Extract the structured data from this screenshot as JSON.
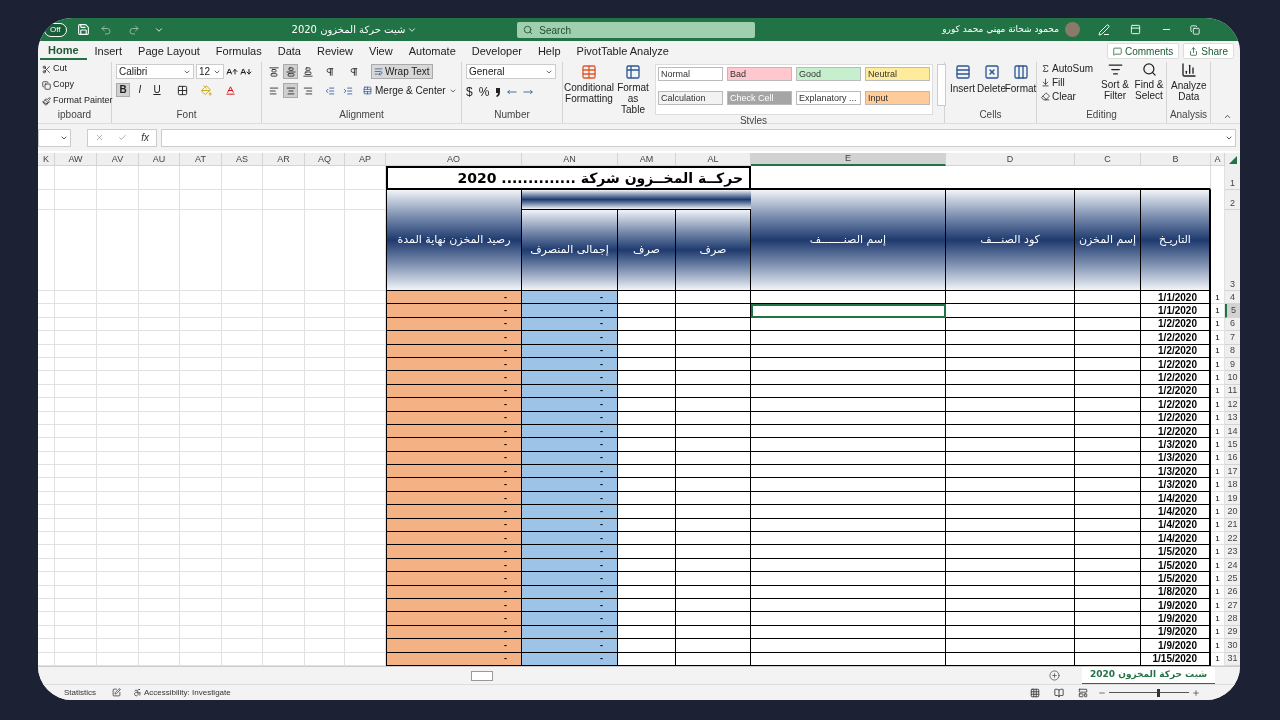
{
  "title_bar": {
    "autosave": "Off",
    "title": "شيت حركة المخزون 2020",
    "search": {
      "placeholder": "Search"
    },
    "user": "محمود شحاتة مهني محمد كورو"
  },
  "tabs": [
    {
      "label": "Home",
      "selected": true
    },
    {
      "label": "Insert",
      "selected": false
    },
    {
      "label": "Page Layout",
      "selected": false
    },
    {
      "label": "Formulas",
      "selected": false
    },
    {
      "label": "Data",
      "selected": false
    },
    {
      "label": "Review",
      "selected": false
    },
    {
      "label": "View",
      "selected": false
    },
    {
      "label": "Automate",
      "selected": false
    },
    {
      "label": "Developer",
      "selected": false
    },
    {
      "label": "Help",
      "selected": false
    },
    {
      "label": "PivotTable Analyze",
      "selected": false
    }
  ],
  "actions": [
    "Comments",
    "Share"
  ],
  "ribbon": {
    "clipboard": {
      "label": "ipboard",
      "items": [
        {
          "kind": "cut",
          "label": "Cut"
        },
        {
          "kind": "copy",
          "label": "Copy"
        },
        {
          "kind": "painter",
          "label": "Format Painter"
        }
      ]
    },
    "font": {
      "label": "Font",
      "family": "Calibri",
      "size": "12",
      "styles": [
        {
          "label": "B",
          "selected": true
        },
        {
          "label": "I",
          "selected": false
        },
        {
          "label": "U",
          "selected": false
        }
      ]
    },
    "alignment": {
      "label": "Alignment",
      "aligns": [
        {
          "kind": "top",
          "selected": false
        },
        {
          "kind": "middle",
          "selected": true
        },
        {
          "kind": "bottom",
          "selected": false
        },
        {
          "kind": "left",
          "selected": false
        },
        {
          "kind": "center",
          "selected": true
        },
        {
          "kind": "right",
          "selected": false
        }
      ],
      "wrap": {
        "label": "Wrap Text",
        "selected": true
      },
      "merge": "Merge & Center"
    },
    "number": {
      "label": "Number",
      "format": "General",
      "symbols": [
        "$",
        "%"
      ]
    },
    "styles": {
      "label": "Styles",
      "conditional": "Conditional Formatting",
      "format_table": "Format as Table",
      "cells": [
        {
          "label": "Normal",
          "color": "#ffffff"
        },
        {
          "label": "Bad",
          "color": "#ffc7ce"
        },
        {
          "label": "Good",
          "color": "#c6efce"
        },
        {
          "label": "Neutral",
          "color": "#ffeb9c"
        },
        {
          "label": "Calculation",
          "color": "#f2f2f2"
        },
        {
          "label": "Check Cell",
          "color": "#a5a5a5"
        },
        {
          "label": "Explanatory ...",
          "color": "#ffffff"
        },
        {
          "label": "Input",
          "color": "#ffcc99"
        }
      ]
    },
    "cells": {
      "label": "Cells",
      "items": [
        {
          "kind": "insert",
          "label": "Insert"
        },
        {
          "kind": "delete",
          "label": "Delete"
        },
        {
          "kind": "format",
          "label": "Format"
        }
      ]
    },
    "editing": {
      "label": "Editing",
      "items": [
        {
          "kind": "autosum",
          "label": "AutoSum"
        },
        {
          "kind": "fill",
          "label": "Fill"
        },
        {
          "kind": "clear",
          "label": "Clear"
        }
      ],
      "big": [
        {
          "kind": "sort",
          "label": "Sort & Filter"
        },
        {
          "kind": "find",
          "label": "Find & Select"
        }
      ]
    },
    "analysis": {
      "label": "Analysis",
      "button": "Analyze Data"
    }
  },
  "formula_bar": {
    "function_label": "fx"
  },
  "sheet": {
    "columns": [
      {
        "label": "K",
        "selected": false
      },
      {
        "label": "AW",
        "selected": false
      },
      {
        "label": "AV",
        "selected": false
      },
      {
        "label": "AU",
        "selected": false
      },
      {
        "label": "AT",
        "selected": false
      },
      {
        "label": "AS",
        "selected": false
      },
      {
        "label": "AR",
        "selected": false
      },
      {
        "label": "AQ",
        "selected": false
      },
      {
        "label": "AP",
        "selected": false
      },
      {
        "label": "AO",
        "selected": false
      },
      {
        "label": "AN",
        "selected": false
      },
      {
        "label": "AM",
        "selected": false
      },
      {
        "label": "AL",
        "selected": false
      },
      {
        "label": "E",
        "selected": true
      },
      {
        "label": "D",
        "selected": false
      },
      {
        "label": "C",
        "selected": false
      },
      {
        "label": "B",
        "selected": false
      },
      {
        "label": "A",
        "selected": false
      }
    ],
    "title": "حركــة المخــزون شركة .............. 2020",
    "headers": {
      "ao": "رصيد المخزن نهاية المدة",
      "an": "إجمالى المنصرف",
      "am": "صرف",
      "al": "صرف",
      "e": "إسم الصنـــــــف",
      "d": "كود الصنـــف",
      "c": "إسم المخزن",
      "b": "التاريـخ"
    },
    "header_rows": [
      "1",
      "2",
      "3"
    ],
    "rows": [
      {
        "row": "4",
        "date": "1/1/2020",
        "a": "1",
        "ao": "-",
        "an": "-",
        "selected": false
      },
      {
        "row": "5",
        "date": "1/1/2020",
        "a": "1",
        "ao": "-",
        "an": "-",
        "selected": true
      },
      {
        "row": "6",
        "date": "1/2/2020",
        "a": "1",
        "ao": "-",
        "an": "-",
        "selected": false
      },
      {
        "row": "7",
        "date": "1/2/2020",
        "a": "1",
        "ao": "-",
        "an": "-",
        "selected": false
      },
      {
        "row": "8",
        "date": "1/2/2020",
        "a": "1",
        "ao": "-",
        "an": "-",
        "selected": false
      },
      {
        "row": "9",
        "date": "1/2/2020",
        "a": "1",
        "ao": "-",
        "an": "-",
        "selected": false
      },
      {
        "row": "10",
        "date": "1/2/2020",
        "a": "1",
        "ao": "-",
        "an": "-",
        "selected": false
      },
      {
        "row": "11",
        "date": "1/2/2020",
        "a": "1",
        "ao": "-",
        "an": "-",
        "selected": false
      },
      {
        "row": "12",
        "date": "1/2/2020",
        "a": "1",
        "ao": "-",
        "an": "-",
        "selected": false
      },
      {
        "row": "13",
        "date": "1/2/2020",
        "a": "1",
        "ao": "-",
        "an": "-",
        "selected": false
      },
      {
        "row": "14",
        "date": "1/2/2020",
        "a": "1",
        "ao": "-",
        "an": "-",
        "selected": false
      },
      {
        "row": "15",
        "date": "1/3/2020",
        "a": "1",
        "ao": "-",
        "an": "-",
        "selected": false
      },
      {
        "row": "16",
        "date": "1/3/2020",
        "a": "1",
        "ao": "-",
        "an": "-",
        "selected": false
      },
      {
        "row": "17",
        "date": "1/3/2020",
        "a": "1",
        "ao": "-",
        "an": "-",
        "selected": false
      },
      {
        "row": "18",
        "date": "1/3/2020",
        "a": "1",
        "ao": "-",
        "an": "-",
        "selected": false
      },
      {
        "row": "19",
        "date": "1/4/2020",
        "a": "1",
        "ao": "-",
        "an": "-",
        "selected": false
      },
      {
        "row": "20",
        "date": "1/4/2020",
        "a": "1",
        "ao": "-",
        "an": "-",
        "selected": false
      },
      {
        "row": "21",
        "date": "1/4/2020",
        "a": "1",
        "ao": "-",
        "an": "-",
        "selected": false
      },
      {
        "row": "22",
        "date": "1/4/2020",
        "a": "1",
        "ao": "-",
        "an": "-",
        "selected": false
      },
      {
        "row": "23",
        "date": "1/5/2020",
        "a": "1",
        "ao": "-",
        "an": "-",
        "selected": false
      },
      {
        "row": "24",
        "date": "1/5/2020",
        "a": "1",
        "ao": "-",
        "an": "-",
        "selected": false
      },
      {
        "row": "25",
        "date": "1/5/2020",
        "a": "1",
        "ao": "-",
        "an": "-",
        "selected": false
      },
      {
        "row": "26",
        "date": "1/8/2020",
        "a": "1",
        "ao": "-",
        "an": "-",
        "selected": false
      },
      {
        "row": "27",
        "date": "1/9/2020",
        "a": "1",
        "ao": "-",
        "an": "-",
        "selected": false
      },
      {
        "row": "28",
        "date": "1/9/2020",
        "a": "1",
        "ao": "-",
        "an": "-",
        "selected": false
      },
      {
        "row": "29",
        "date": "1/9/2020",
        "a": "1",
        "ao": "-",
        "an": "-",
        "selected": false
      },
      {
        "row": "30",
        "date": "1/9/2020",
        "a": "1",
        "ao": "-",
        "an": "-",
        "selected": false
      },
      {
        "row": "31",
        "date": "1/15/2020",
        "a": "1",
        "ao": "-",
        "an": "-",
        "selected": false
      }
    ]
  },
  "sheet_tabs": [
    {
      "label": "شيت حركة المخزون  2020",
      "selected": true
    }
  ],
  "status_bar": {
    "items": [
      "Statistics",
      "Accessibility: Investigate"
    ],
    "zoom": {
      "level": 0.6
    }
  }
}
